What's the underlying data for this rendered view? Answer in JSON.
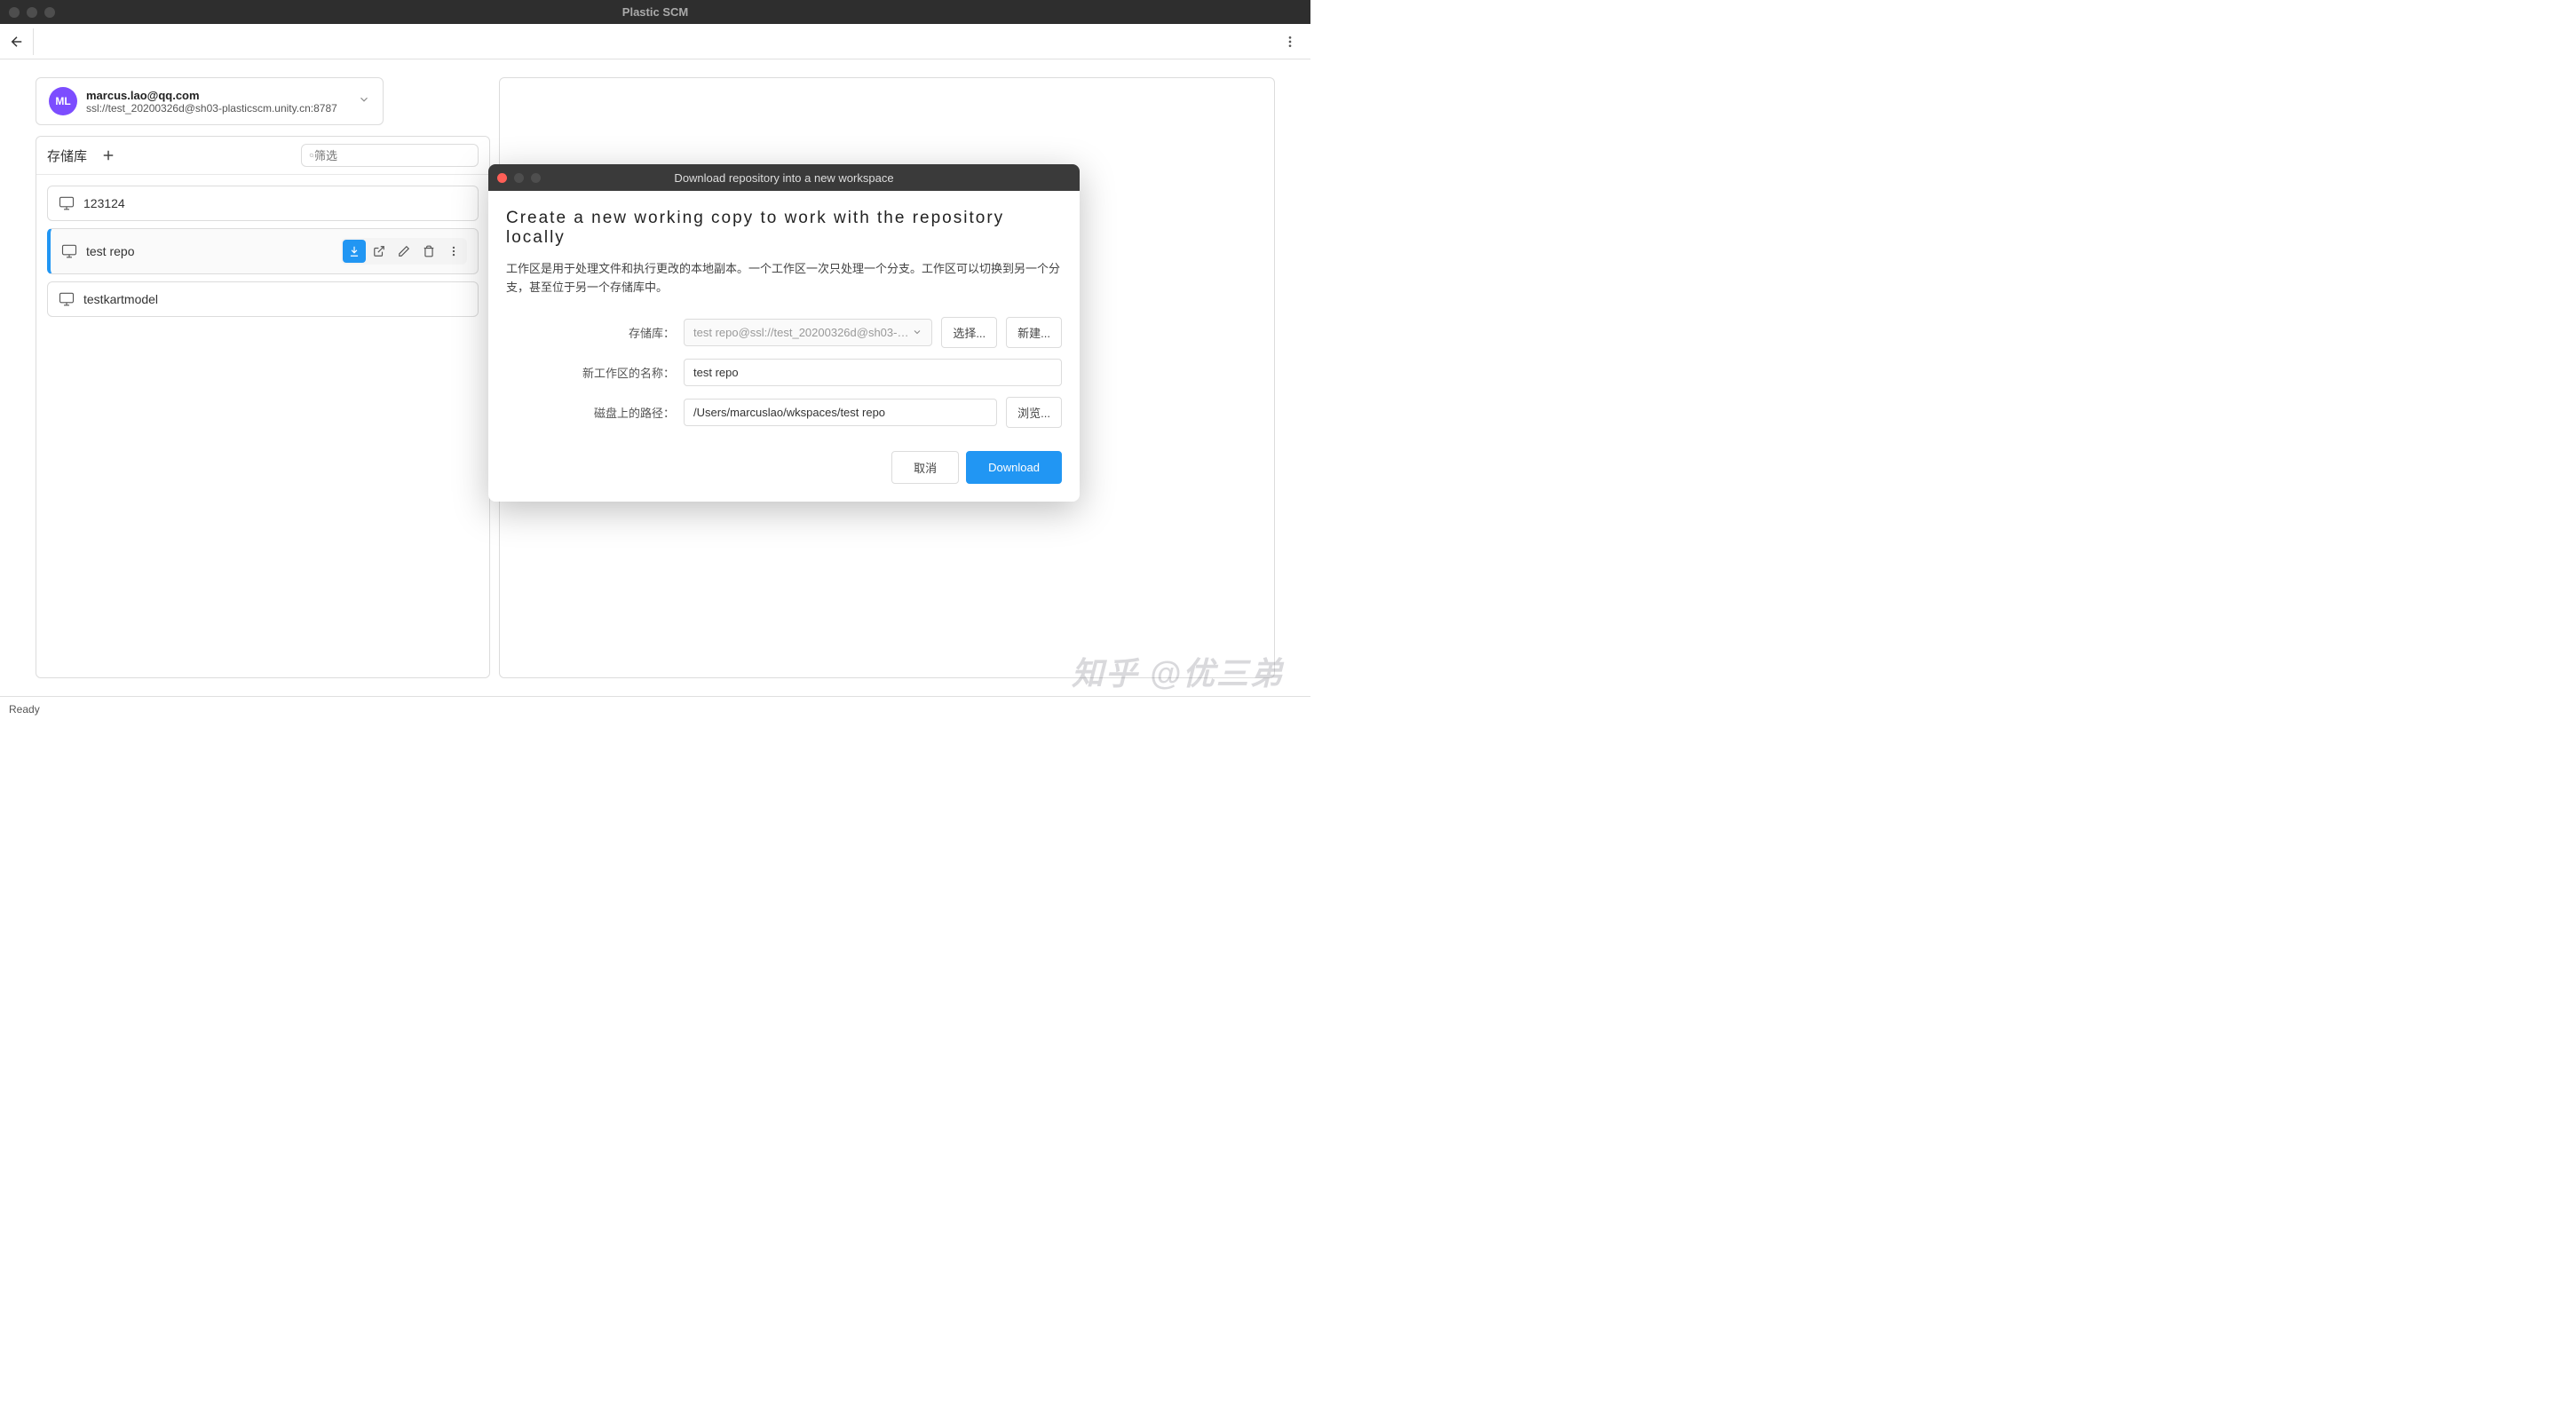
{
  "window": {
    "title": "Plastic SCM"
  },
  "account": {
    "initials": "ML",
    "email": "marcus.lao@qq.com",
    "server": "ssl://test_20200326d@sh03-plasticscm.unity.cn:8787"
  },
  "sidebar": {
    "title": "存储库",
    "search_placeholder": "筛选"
  },
  "repos": [
    {
      "name": "123124"
    },
    {
      "name": "test repo"
    },
    {
      "name": "testkartmodel"
    }
  ],
  "modal": {
    "title": "Download repository into a new workspace",
    "heading": "Create a new working copy to work with the repository locally",
    "description": "工作区是用于处理文件和执行更改的本地副本。一个工作区一次只处理一个分支。工作区可以切换到另一个分支，甚至位于另一个存储库中。",
    "repo_label": "存储库：",
    "repo_value": "test repo@ssl://test_20200326d@sh03-plas",
    "select_btn": "选择...",
    "new_btn": "新建...",
    "name_label": "新工作区的名称：",
    "name_value": "test repo",
    "path_label": "磁盘上的路径：",
    "path_value": "/Users/marcuslao/wkspaces/test repo",
    "browse_btn": "浏览...",
    "cancel_btn": "取消",
    "download_btn": "Download"
  },
  "status": "Ready",
  "watermark": "知乎 @优三弟"
}
